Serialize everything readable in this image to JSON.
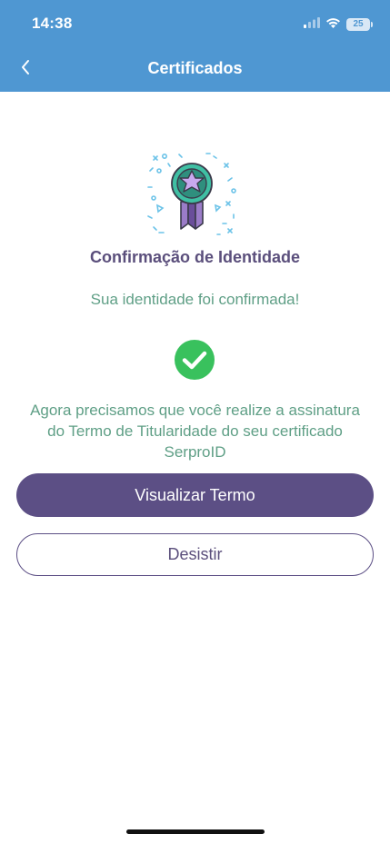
{
  "status_bar": {
    "time": "14:38",
    "battery": "25",
    "icons": [
      "signal-icon",
      "wifi-icon",
      "battery-icon"
    ]
  },
  "nav": {
    "back_icon": "chevron-left-icon",
    "title": "Certificados"
  },
  "main": {
    "illustration_icon": "certificate-ribbon-icon",
    "title": "Confirmação de Identidade",
    "subtitle": "Sua identidade foi confirmada!",
    "status_icon": "check-circle-icon",
    "message": "Agora precisamos que você realize a assinatura do Termo de Titularidade do seu certificado SerproID"
  },
  "actions": {
    "primary_label": "Visualizar Termo",
    "secondary_label": "Desistir"
  },
  "colors": {
    "header": "#4f97d2",
    "primary": "#5c4f85",
    "accent_text": "#5f9f86",
    "success": "#39c15d"
  }
}
